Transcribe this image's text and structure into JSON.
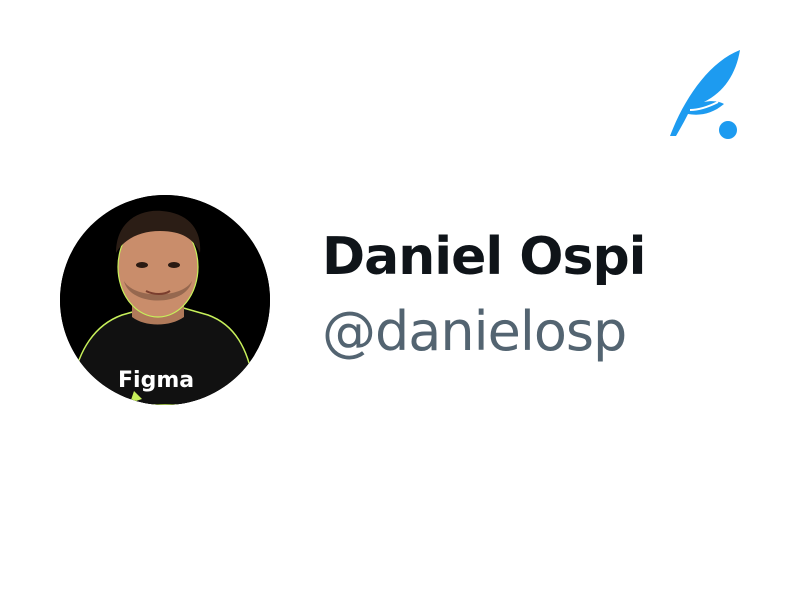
{
  "app": {
    "logo_icon": "quill-feather-icon",
    "accent_color": "#1d9bf0"
  },
  "profile": {
    "display_name": "Daniel Ospi",
    "handle": "@danielosp",
    "avatar_icon": "profile-photo",
    "shirt_text": "Figma",
    "name_color": "#0f1419",
    "handle_color": "#536471"
  }
}
